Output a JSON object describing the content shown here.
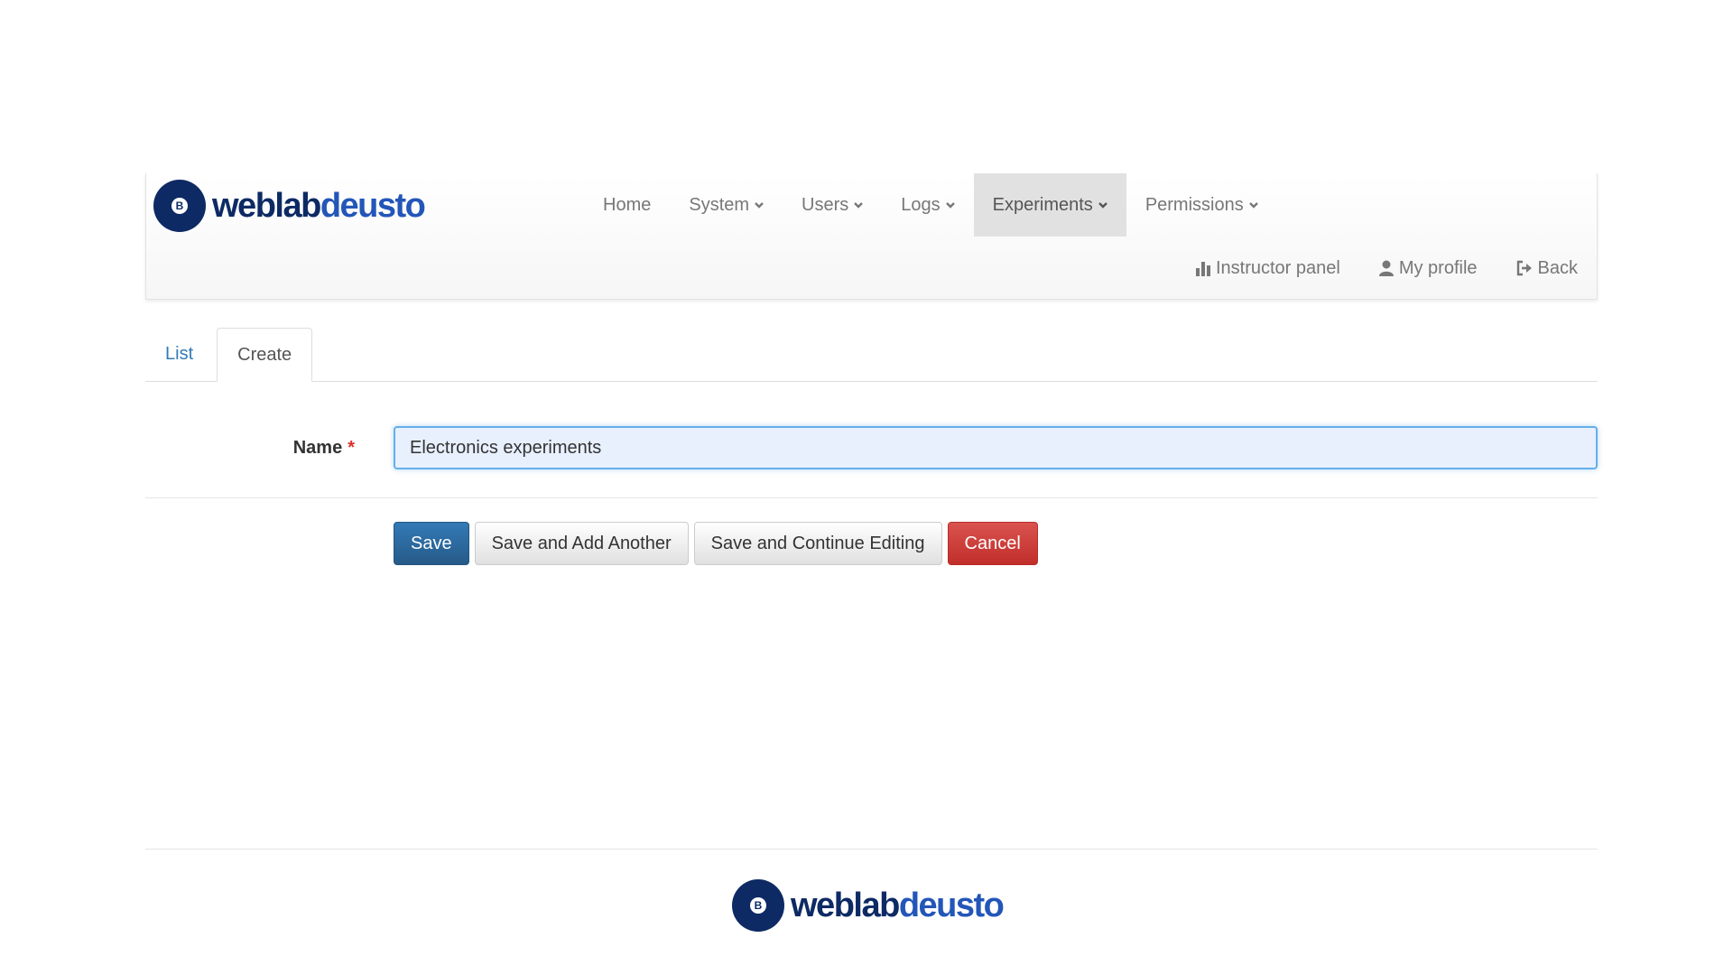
{
  "brand": {
    "name_part1": "weblab",
    "name_part2": "deusto",
    "logo_glyph": "B"
  },
  "nav": {
    "items": [
      {
        "label": "Home",
        "dropdown": false,
        "active": false
      },
      {
        "label": "System",
        "dropdown": true,
        "active": false
      },
      {
        "label": "Users",
        "dropdown": true,
        "active": false
      },
      {
        "label": "Logs",
        "dropdown": true,
        "active": false
      },
      {
        "label": "Experiments",
        "dropdown": true,
        "active": true
      },
      {
        "label": "Permissions",
        "dropdown": true,
        "active": false
      }
    ],
    "right": [
      {
        "label": "Instructor panel",
        "icon": "bar-chart-icon"
      },
      {
        "label": "My profile",
        "icon": "user-icon"
      },
      {
        "label": "Back",
        "icon": "sign-out-icon"
      }
    ]
  },
  "tabs": [
    {
      "label": "List",
      "active": false
    },
    {
      "label": "Create",
      "active": true
    }
  ],
  "form": {
    "name_label": "Name",
    "required_mark": "*",
    "name_value": "Electronics experiments"
  },
  "actions": {
    "save": "Save",
    "save_add_another": "Save and Add Another",
    "save_continue": "Save and Continue Editing",
    "cancel": "Cancel"
  },
  "colors": {
    "brand_dark": "#0d2a64",
    "brand_light": "#2356b8",
    "primary": "#337ab7",
    "danger": "#d9534f",
    "active_nav_bg": "#e1e1e1"
  }
}
